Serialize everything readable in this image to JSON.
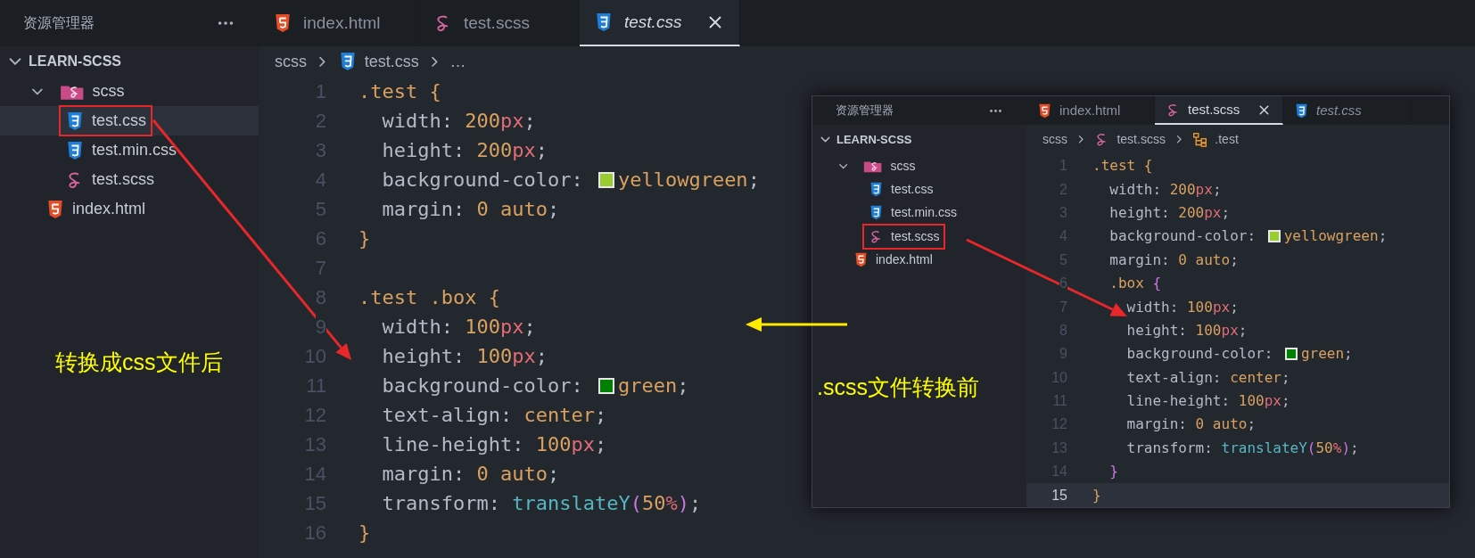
{
  "main": {
    "explorer_title": "资源管理器",
    "tabs": [
      {
        "label": "index.html",
        "kind": "html",
        "selected": false,
        "preview": false
      },
      {
        "label": "test.scss",
        "kind": "scss",
        "selected": false,
        "preview": false
      },
      {
        "label": "test.css",
        "kind": "css",
        "selected": true,
        "preview": true
      }
    ],
    "tree": {
      "label": "LEARN-SCSS",
      "expanded": true,
      "children": [
        {
          "label": "scss",
          "kind": "folder",
          "expanded": true,
          "selected": false,
          "boxed": false,
          "children": [
            {
              "label": "test.css",
              "kind": "css",
              "selected": true,
              "boxed": true
            },
            {
              "label": "test.min.css",
              "kind": "css",
              "selected": false,
              "boxed": false
            },
            {
              "label": "test.scss",
              "kind": "scss",
              "selected": false,
              "boxed": false
            }
          ]
        },
        {
          "label": "index.html",
          "kind": "html",
          "selected": false,
          "boxed": false
        }
      ]
    },
    "breadcrumbs": [
      {
        "kind": "folder",
        "text": "scss"
      },
      {
        "kind": "css",
        "text": "test.css"
      },
      {
        "kind": "more",
        "text": "…"
      }
    ],
    "lines": [
      {
        "number": "1",
        "current": false,
        "tokens": [
          {
            "kind": "sel",
            "text": ".test"
          },
          {
            "kind": "brace",
            "text": " {"
          }
        ]
      },
      {
        "number": "2",
        "current": false,
        "tokens": [
          {
            "kind": "prop",
            "text": "  width"
          },
          {
            "kind": "p",
            "text": ": "
          },
          {
            "kind": "num",
            "text": "200"
          },
          {
            "kind": "unit",
            "text": "px"
          },
          {
            "kind": "p",
            "text": ";"
          }
        ]
      },
      {
        "number": "3",
        "current": false,
        "tokens": [
          {
            "kind": "prop",
            "text": "  height"
          },
          {
            "kind": "p",
            "text": ": "
          },
          {
            "kind": "num",
            "text": "200"
          },
          {
            "kind": "unit",
            "text": "px"
          },
          {
            "kind": "p",
            "text": ";"
          }
        ]
      },
      {
        "number": "4",
        "current": false,
        "tokens": [
          {
            "kind": "prop",
            "text": "  background-color"
          },
          {
            "kind": "p",
            "text": ": "
          },
          {
            "kind": "swatch",
            "color": "#9acd32"
          },
          {
            "kind": "kw",
            "text": "yellowgreen"
          },
          {
            "kind": "p",
            "text": ";"
          }
        ]
      },
      {
        "number": "5",
        "current": false,
        "tokens": [
          {
            "kind": "prop",
            "text": "  margin"
          },
          {
            "kind": "p",
            "text": ": "
          },
          {
            "kind": "kw",
            "text": "0 auto"
          },
          {
            "kind": "p",
            "text": ";"
          }
        ]
      },
      {
        "number": "6",
        "current": false,
        "tokens": [
          {
            "kind": "brace",
            "text": "}"
          }
        ]
      },
      {
        "number": "7",
        "current": false
      },
      {
        "number": "8",
        "current": false,
        "tokens": [
          {
            "kind": "sel",
            "text": ".test .box"
          },
          {
            "kind": "brace",
            "text": " {"
          }
        ]
      },
      {
        "number": "9",
        "current": false,
        "tokens": [
          {
            "kind": "prop",
            "text": "  width"
          },
          {
            "kind": "p",
            "text": ": "
          },
          {
            "kind": "num",
            "text": "100"
          },
          {
            "kind": "unit",
            "text": "px"
          },
          {
            "kind": "p",
            "text": ";"
          }
        ]
      },
      {
        "number": "10",
        "current": false,
        "tokens": [
          {
            "kind": "prop",
            "text": "  height"
          },
          {
            "kind": "p",
            "text": ": "
          },
          {
            "kind": "num",
            "text": "100"
          },
          {
            "kind": "unit",
            "text": "px"
          },
          {
            "kind": "p",
            "text": ";"
          }
        ]
      },
      {
        "number": "11",
        "current": false,
        "tokens": [
          {
            "kind": "prop",
            "text": "  background-color"
          },
          {
            "kind": "p",
            "text": ": "
          },
          {
            "kind": "swatch",
            "color": "#008000"
          },
          {
            "kind": "kw",
            "text": "green"
          },
          {
            "kind": "p",
            "text": ";"
          }
        ]
      },
      {
        "number": "12",
        "current": false,
        "tokens": [
          {
            "kind": "prop",
            "text": "  text-align"
          },
          {
            "kind": "p",
            "text": ": "
          },
          {
            "kind": "kw",
            "text": "center"
          },
          {
            "kind": "p",
            "text": ";"
          }
        ]
      },
      {
        "number": "13",
        "current": false,
        "tokens": [
          {
            "kind": "prop",
            "text": "  line-height"
          },
          {
            "kind": "p",
            "text": ": "
          },
          {
            "kind": "num",
            "text": "100"
          },
          {
            "kind": "unit",
            "text": "px"
          },
          {
            "kind": "p",
            "text": ";"
          }
        ]
      },
      {
        "number": "14",
        "current": false,
        "tokens": [
          {
            "kind": "prop",
            "text": "  margin"
          },
          {
            "kind": "p",
            "text": ": "
          },
          {
            "kind": "kw",
            "text": "0 auto"
          },
          {
            "kind": "p",
            "text": ";"
          }
        ]
      },
      {
        "number": "15",
        "current": false,
        "tokens": [
          {
            "kind": "prop",
            "text": "  transform"
          },
          {
            "kind": "p",
            "text": ": "
          },
          {
            "kind": "fn",
            "text": "translateY"
          },
          {
            "kind": "paren",
            "text": "("
          },
          {
            "kind": "num",
            "text": "50"
          },
          {
            "kind": "unit",
            "text": "%"
          },
          {
            "kind": "paren",
            "text": ")"
          },
          {
            "kind": "p",
            "text": ";"
          }
        ]
      },
      {
        "number": "16",
        "current": false,
        "tokens": [
          {
            "kind": "brace",
            "text": "}"
          }
        ]
      }
    ]
  },
  "inset": {
    "explorer_title": "资源管理器",
    "tabs": [
      {
        "label": "index.html",
        "kind": "html",
        "selected": false,
        "preview": false
      },
      {
        "label": "test.scss",
        "kind": "scss",
        "selected": true,
        "preview": false
      },
      {
        "label": "test.css",
        "kind": "css",
        "selected": false,
        "preview": true
      }
    ],
    "tree": {
      "label": "LEARN-SCSS",
      "expanded": true,
      "children": [
        {
          "label": "scss",
          "kind": "folder",
          "expanded": true,
          "selected": false,
          "boxed": false,
          "children": [
            {
              "label": "test.css",
              "kind": "css",
              "selected": false,
              "boxed": false
            },
            {
              "label": "test.min.css",
              "kind": "css",
              "selected": false,
              "boxed": false
            },
            {
              "label": "test.scss",
              "kind": "scss",
              "selected": false,
              "boxed": true
            }
          ]
        },
        {
          "label": "index.html",
          "kind": "html",
          "selected": false,
          "boxed": false
        }
      ]
    },
    "breadcrumbs": [
      {
        "kind": "folder",
        "text": "scss"
      },
      {
        "kind": "scss",
        "text": "test.scss"
      },
      {
        "kind": "symbol",
        "text": ".test"
      }
    ],
    "lines": [
      {
        "number": "1",
        "current": false,
        "tokens": [
          {
            "kind": "sel",
            "text": ".test"
          },
          {
            "kind": "brace",
            "text": " {"
          }
        ]
      },
      {
        "number": "2",
        "current": false,
        "tokens": [
          {
            "kind": "prop",
            "text": "  width"
          },
          {
            "kind": "p",
            "text": ": "
          },
          {
            "kind": "num",
            "text": "200"
          },
          {
            "kind": "unit",
            "text": "px"
          },
          {
            "kind": "p",
            "text": ";"
          }
        ]
      },
      {
        "number": "3",
        "current": false,
        "tokens": [
          {
            "kind": "prop",
            "text": "  height"
          },
          {
            "kind": "p",
            "text": ": "
          },
          {
            "kind": "num",
            "text": "200"
          },
          {
            "kind": "unit",
            "text": "px"
          },
          {
            "kind": "p",
            "text": ";"
          }
        ]
      },
      {
        "number": "4",
        "current": false,
        "tokens": [
          {
            "kind": "prop",
            "text": "  background-color"
          },
          {
            "kind": "p",
            "text": ": "
          },
          {
            "kind": "swatch",
            "color": "#9acd32"
          },
          {
            "kind": "kw",
            "text": "yellowgreen"
          },
          {
            "kind": "p",
            "text": ";"
          }
        ]
      },
      {
        "number": "5",
        "current": false,
        "tokens": [
          {
            "kind": "prop",
            "text": "  margin"
          },
          {
            "kind": "p",
            "text": ": "
          },
          {
            "kind": "kw",
            "text": "0 auto"
          },
          {
            "kind": "p",
            "text": ";"
          }
        ]
      },
      {
        "number": "6",
        "current": false,
        "tokens": [
          {
            "kind": "sel",
            "text": "  .box"
          },
          {
            "kind": "brace2",
            "text": " {"
          }
        ]
      },
      {
        "number": "7",
        "current": false,
        "tokens": [
          {
            "kind": "prop",
            "text": "    width"
          },
          {
            "kind": "p",
            "text": ": "
          },
          {
            "kind": "num",
            "text": "100"
          },
          {
            "kind": "unit",
            "text": "px"
          },
          {
            "kind": "p",
            "text": ";"
          }
        ]
      },
      {
        "number": "8",
        "current": false,
        "tokens": [
          {
            "kind": "prop",
            "text": "    height"
          },
          {
            "kind": "p",
            "text": ": "
          },
          {
            "kind": "num",
            "text": "100"
          },
          {
            "kind": "unit",
            "text": "px"
          },
          {
            "kind": "p",
            "text": ";"
          }
        ]
      },
      {
        "number": "9",
        "current": false,
        "tokens": [
          {
            "kind": "prop",
            "text": "    background-color"
          },
          {
            "kind": "p",
            "text": ": "
          },
          {
            "kind": "swatch",
            "color": "#008000"
          },
          {
            "kind": "kw",
            "text": "green"
          },
          {
            "kind": "p",
            "text": ";"
          }
        ]
      },
      {
        "number": "10",
        "current": false,
        "tokens": [
          {
            "kind": "prop",
            "text": "    text-align"
          },
          {
            "kind": "p",
            "text": ": "
          },
          {
            "kind": "kw",
            "text": "center"
          },
          {
            "kind": "p",
            "text": ";"
          }
        ]
      },
      {
        "number": "11",
        "current": false,
        "tokens": [
          {
            "kind": "prop",
            "text": "    line-height"
          },
          {
            "kind": "p",
            "text": ": "
          },
          {
            "kind": "num",
            "text": "100"
          },
          {
            "kind": "unit",
            "text": "px"
          },
          {
            "kind": "p",
            "text": ";"
          }
        ]
      },
      {
        "number": "12",
        "current": false,
        "tokens": [
          {
            "kind": "prop",
            "text": "    margin"
          },
          {
            "kind": "p",
            "text": ": "
          },
          {
            "kind": "kw",
            "text": "0 auto"
          },
          {
            "kind": "p",
            "text": ";"
          }
        ]
      },
      {
        "number": "13",
        "current": false,
        "tokens": [
          {
            "kind": "prop",
            "text": "    transform"
          },
          {
            "kind": "p",
            "text": ": "
          },
          {
            "kind": "fn",
            "text": "translateY"
          },
          {
            "kind": "paren",
            "text": "("
          },
          {
            "kind": "num",
            "text": "50"
          },
          {
            "kind": "unit",
            "text": "%"
          },
          {
            "kind": "paren",
            "text": ")"
          },
          {
            "kind": "p",
            "text": ";"
          }
        ]
      },
      {
        "number": "14",
        "current": false,
        "tokens": [
          {
            "kind": "brace2",
            "text": "  }"
          }
        ]
      },
      {
        "number": "15",
        "current": true,
        "tokens": [
          {
            "kind": "brace",
            "text": "}"
          }
        ]
      }
    ]
  },
  "notes": [
    {
      "text": "转换成css文件后"
    },
    {
      "text": ".scss文件转换前"
    }
  ]
}
